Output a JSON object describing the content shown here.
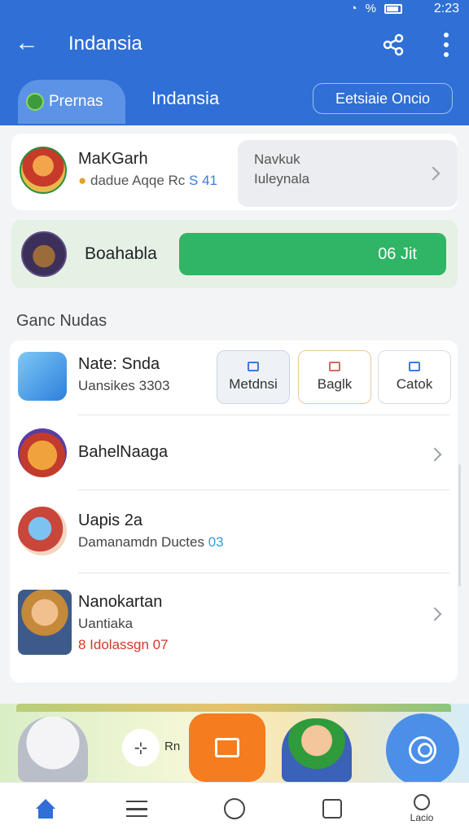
{
  "status": {
    "battery": "%",
    "time": "2:23"
  },
  "appbar": {
    "title": "Indansia"
  },
  "tabs": {
    "active": "Prernas",
    "second": "Indansia",
    "button": "Eetsiaie Oncio"
  },
  "card1": {
    "name": "MaKGarh",
    "sub_text": "dadue Aqqe Rc",
    "sub_accent": "S 41",
    "side_line1": "Navkuk",
    "side_line2": "Iuleynala"
  },
  "card2": {
    "name": "Boahabla",
    "pill": "06 Jit"
  },
  "section_title": "Ganc Nudas",
  "list": {
    "row1": {
      "name": "Nate: Snda",
      "sub": "Uansikes 3303",
      "actions": [
        "Metdnsi",
        "Baglk",
        "Catok"
      ]
    },
    "row2": {
      "name": "BahelNaaga"
    },
    "row3": {
      "name": "Uapis 2a",
      "sub": "Damanamdn Ductes",
      "sub_accent": "03"
    },
    "row4": {
      "name": "Nanokartan",
      "sub": "Uantiaka",
      "extra": "8 Idolassgn 07"
    }
  },
  "banner": {
    "chip_label": "Rn"
  },
  "nav": {
    "user_label": "Lacio"
  },
  "colors": {
    "primary": "#2f6fd6",
    "green": "#2fb565",
    "orange": "#f57c1f",
    "red_text": "#d13a2a"
  },
  "icons": [
    "back-arrow-icon",
    "share-icon",
    "more-icon",
    "chevron-right-icon",
    "home-icon",
    "menu-icon",
    "circle-icon",
    "bag-icon",
    "user-icon"
  ]
}
